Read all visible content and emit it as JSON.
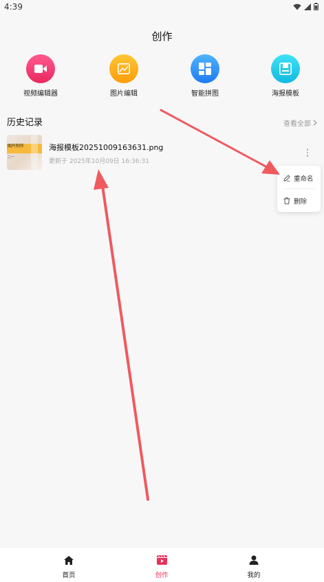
{
  "status_bar": {
    "time": "4:39"
  },
  "page": {
    "title": "创作"
  },
  "tools": [
    {
      "label": "视频编辑器",
      "icon": "video-camera-icon",
      "color_top": "#ff5a8f",
      "color_bottom": "#e8285f"
    },
    {
      "label": "图片编辑",
      "icon": "image-icon",
      "color_top": "#ffc533",
      "color_bottom": "#ff9d0a"
    },
    {
      "label": "智能拼图",
      "icon": "collage-grid-icon",
      "color_top": "#4fb3ff",
      "color_bottom": "#1f7bf2"
    },
    {
      "label": "海报模板",
      "icon": "poster-save-icon",
      "color_top": "#3fe3f5",
      "color_bottom": "#12b9e0"
    }
  ],
  "history": {
    "title": "历史记录",
    "view_all": "查看全部",
    "items": [
      {
        "name": "海报模板20251009163631.png",
        "updated": "更新于 2025年10月09日 16:36:31",
        "thumb_text_1": "图片制作",
        "thumb_text_2": "二一"
      }
    ]
  },
  "context_menu": {
    "rename": "重命名",
    "delete": "删除"
  },
  "bottom_nav": [
    {
      "label": "首页",
      "icon": "home-icon",
      "active": false
    },
    {
      "label": "创作",
      "icon": "film-icon",
      "active": true
    },
    {
      "label": "我的",
      "icon": "user-icon",
      "active": false
    }
  ],
  "colors": {
    "accent": "#e8315b",
    "annotation_arrow": "#ef5a5f"
  }
}
